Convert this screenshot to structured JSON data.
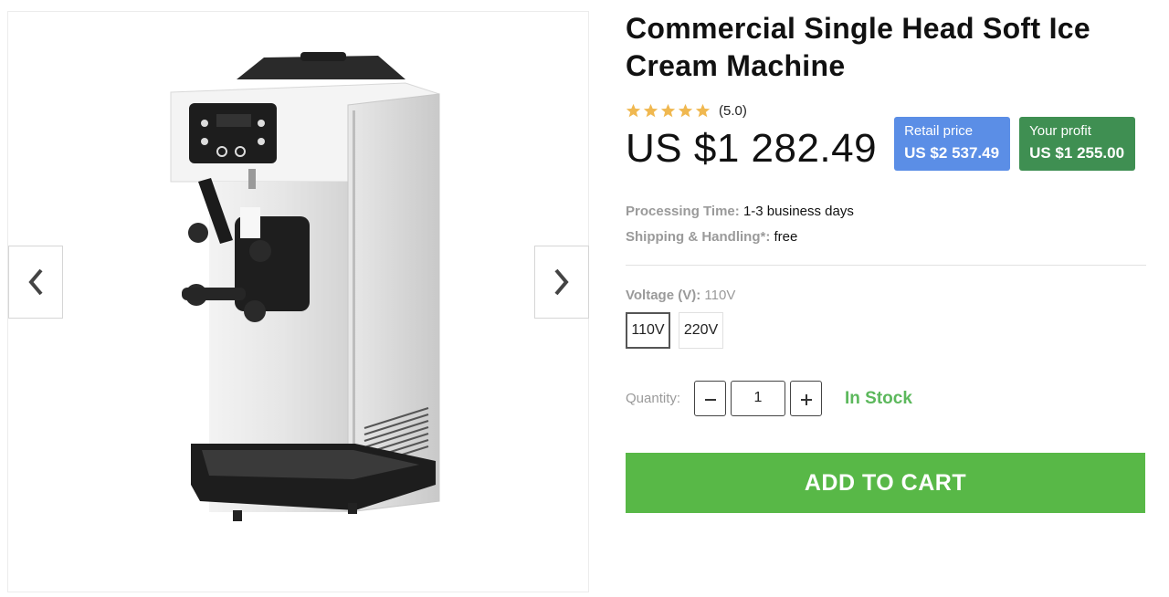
{
  "product": {
    "title": "Commercial Single Head Soft Ice Cream Machine",
    "rating": 5,
    "rating_text": "(5.0)",
    "price": "US $1 282.49"
  },
  "badges": {
    "retail_label": "Retail price",
    "retail_value": "US $2 537.49",
    "profit_label": "Your profit",
    "profit_value": "US $1 255.00"
  },
  "info": {
    "processing_label": "Processing Time:",
    "processing_value": "1-3 business days",
    "shipping_label": "Shipping & Handling*:",
    "shipping_value": "free"
  },
  "voltage": {
    "label": "Voltage (V):",
    "selected": "110V",
    "options": [
      "110V",
      "220V"
    ]
  },
  "quantity": {
    "label": "Quantity:",
    "value": "1",
    "stock": "In Stock"
  },
  "cart": {
    "label": "ADD TO CART"
  },
  "colors": {
    "star": "#f0b850",
    "retail_badge": "#5b8ee6",
    "profit_badge": "#3f8f52",
    "in_stock": "#5cb85c",
    "cart_button": "#58b847"
  },
  "icons": {
    "prev": "chevron-left-icon",
    "next": "chevron-right-icon",
    "minus": "minus-icon",
    "plus": "plus-icon",
    "star": "star-icon"
  }
}
